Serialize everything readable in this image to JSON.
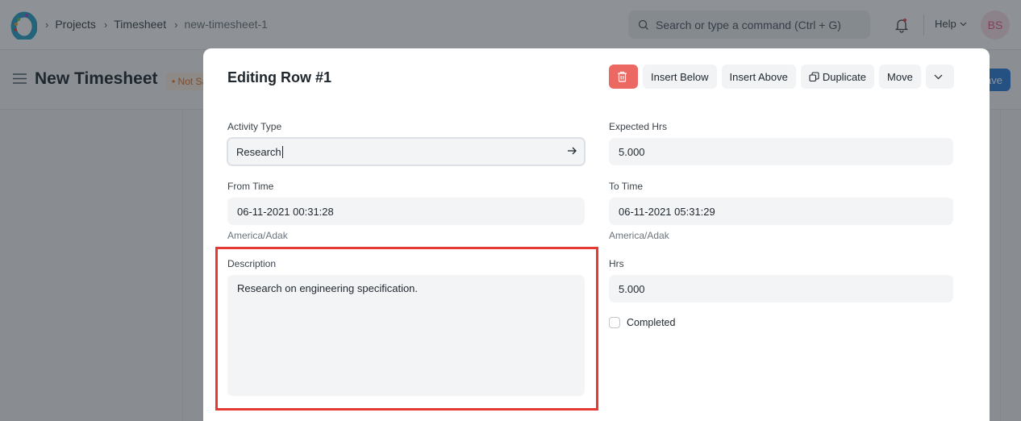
{
  "navbar": {
    "breadcrumb": [
      "Projects",
      "Timesheet",
      "new-timesheet-1"
    ],
    "search_placeholder": "Search or type a command (Ctrl + G)",
    "help_label": "Help",
    "avatar_initials": "BS"
  },
  "page": {
    "title": "New Timesheet",
    "status": "• Not Saved",
    "primary_action": "Save"
  },
  "modal": {
    "title": "Editing Row #1",
    "actions": {
      "delete_icon": "trash-icon",
      "insert_below": "Insert Below",
      "insert_above": "Insert Above",
      "duplicate": "Duplicate",
      "move": "Move",
      "more_icon": "chevron-down-icon"
    },
    "fields": {
      "activity_type": {
        "label": "Activity Type",
        "value": "Research"
      },
      "expected_hrs": {
        "label": "Expected Hrs",
        "value": "5.000"
      },
      "from_time": {
        "label": "From Time",
        "value": "06-11-2021 00:31:28",
        "timezone": "America/Adak"
      },
      "to_time": {
        "label": "To Time",
        "value": "06-11-2021 05:31:29",
        "timezone": "America/Adak"
      },
      "description": {
        "label": "Description",
        "value": "Research on engineering specification."
      },
      "hrs": {
        "label": "Hrs",
        "value": "5.000"
      },
      "completed": {
        "label": "Completed",
        "checked": false
      }
    }
  },
  "colors": {
    "danger": "#eb6962",
    "primary": "#2d7bd6",
    "highlight": "#e53935"
  }
}
